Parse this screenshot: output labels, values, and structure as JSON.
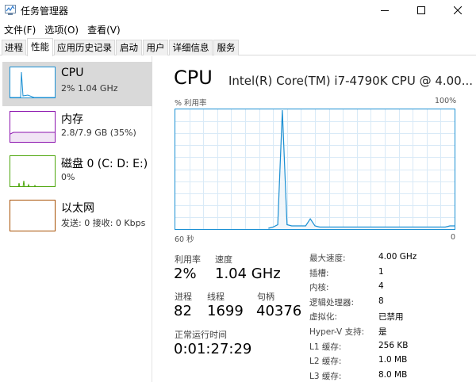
{
  "window": {
    "title": "任务管理器"
  },
  "menu": [
    "文件(F)",
    "选项(O)",
    "查看(V)"
  ],
  "tabs": [
    "进程",
    "性能",
    "应用历史记录",
    "启动",
    "用户",
    "详细信息",
    "服务"
  ],
  "sidebar": {
    "items": [
      {
        "title": "CPU",
        "subtitle": "2% 1.04 GHz",
        "color": "#1a8fd3",
        "selected": true
      },
      {
        "title": "内存",
        "subtitle": "2.8/7.9 GB (35%)",
        "color": "#8b12ae",
        "selected": false
      },
      {
        "title": "磁盘 0 (C: D: E:)",
        "subtitle": "0%",
        "color": "#4da60c",
        "selected": false
      },
      {
        "title": "以太网",
        "subtitle": "发送: 0 接收: 0 Kbps",
        "color": "#a74f01",
        "selected": false
      }
    ]
  },
  "main": {
    "title": "CPU",
    "model": "Intel(R) Core(TM) i7-4790K CPU @ 4.00...",
    "graph_label_left": "% 利用率",
    "graph_label_right": "100%",
    "time_label_left": "60 秒",
    "time_label_right": "0",
    "usage_history_percent": [
      0,
      0,
      0,
      0,
      0,
      0,
      0,
      0,
      0,
      0,
      0,
      0,
      0,
      0,
      0,
      0,
      0,
      0,
      0,
      0,
      0,
      1,
      3,
      100,
      3,
      2,
      2,
      2,
      2,
      8,
      2,
      1,
      1,
      1,
      1,
      1,
      1,
      1,
      1,
      1,
      1,
      1,
      1,
      1,
      1,
      1,
      1,
      1,
      1,
      1,
      1,
      1,
      1,
      1,
      1,
      1,
      1,
      1,
      1,
      2,
      2
    ]
  },
  "stats": {
    "utilization": {
      "label": "利用率",
      "value": "2%"
    },
    "speed": {
      "label": "速度",
      "value": "1.04 GHz"
    },
    "processes": {
      "label": "进程",
      "value": "82"
    },
    "threads": {
      "label": "线程",
      "value": "1699"
    },
    "handles": {
      "label": "句柄",
      "value": "40376"
    },
    "uptime": {
      "label": "正常运行时间",
      "value": "0:01:27:29"
    }
  },
  "specs": [
    {
      "label": "最大速度:",
      "value": "4.00 GHz"
    },
    {
      "label": "插槽:",
      "value": "1"
    },
    {
      "label": "内核:",
      "value": "4"
    },
    {
      "label": "逻辑处理器:",
      "value": "8"
    },
    {
      "label": "虚拟化:",
      "value": "已禁用"
    },
    {
      "label": "Hyper-V 支持:",
      "value": "是"
    },
    {
      "label": "L1 缓存:",
      "value": "256 KB"
    },
    {
      "label": "L2 缓存:",
      "value": "1.0 MB"
    },
    {
      "label": "L3 缓存:",
      "value": "8.0 MB"
    }
  ]
}
